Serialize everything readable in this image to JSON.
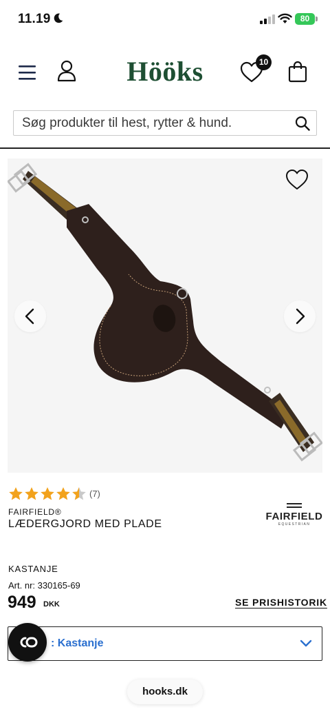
{
  "status_bar": {
    "time": "11.19",
    "battery": "80"
  },
  "header": {
    "logo": "Hööks",
    "wishlist_count": "10",
    "icons": [
      "menu-icon",
      "account-icon",
      "heart-icon",
      "shopping-bag-icon"
    ]
  },
  "search": {
    "placeholder": "Søg produkter til hest, rytter & hund."
  },
  "product": {
    "rating_value": 4.5,
    "rating_max": 5,
    "review_count": "(7)",
    "brand": "FAIRFIELD®",
    "title": "LÆDERGJORD MED PLADE",
    "brand_logo_text": "FAIRFIELD",
    "brand_logo_sub": "EQUESTRIAN",
    "color_name": "KASTANJE",
    "article_number": "Art. nr: 330165-69",
    "price": "949",
    "currency": "DKK",
    "price_history_label": "SE PRISHISTORIK"
  },
  "variant": {
    "selected_label": ": Kastanje"
  },
  "browser": {
    "url": "hooks.dk"
  },
  "colors": {
    "brand_green": "#1e4f33",
    "star": "#f2a21c",
    "link_blue": "#2a6fcf",
    "battery_green": "#35c759"
  }
}
